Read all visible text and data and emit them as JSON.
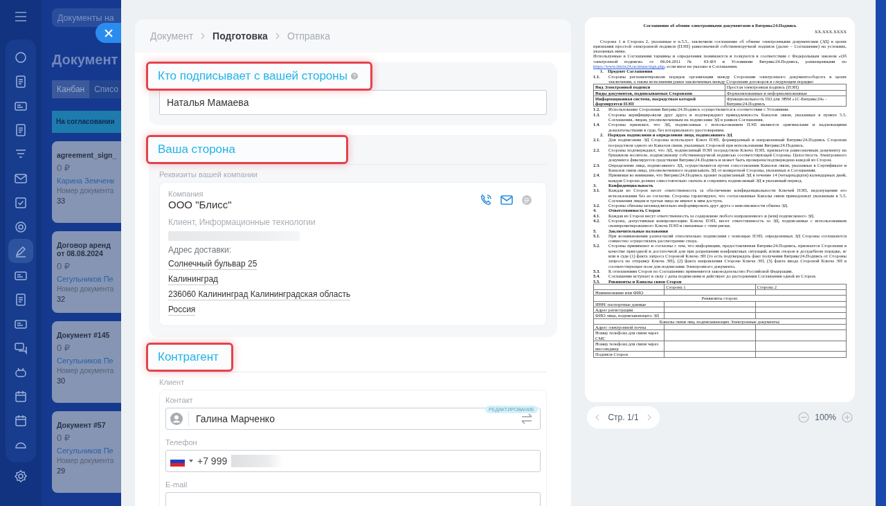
{
  "sidebar": {
    "items": [
      {
        "selected": false
      },
      {
        "selected": false
      },
      {
        "selected": false
      },
      {
        "selected": false
      },
      {
        "selected": false
      },
      {
        "selected": false
      },
      {
        "selected": false
      },
      {
        "selected": false
      },
      {
        "selected": true
      },
      {
        "selected": false
      },
      {
        "selected": false
      },
      {
        "selected": false
      },
      {
        "selected": false
      },
      {
        "selected": false
      },
      {
        "selected": false
      },
      {
        "selected": false
      },
      {
        "selected": false
      }
    ]
  },
  "background": {
    "search": {
      "placeholder": "Документы на"
    },
    "title": "Документ",
    "views": [
      {
        "label": "Канбан",
        "selected": true
      },
      {
        "label": "Списо",
        "selected": false
      }
    ],
    "column": {
      "title": "На согласовании"
    },
    "cards": [
      {
        "title_lines": [
          "agreement_sign_"
        ],
        "amount": "0 ₽",
        "person": "Карина Земченк",
        "number_label": "Номер документа",
        "number": "33"
      },
      {
        "title_lines": [
          "Договор аренд",
          "от 08.08.2024"
        ],
        "amount": "0 ₽",
        "person": "Сегульников Пе",
        "number_label": "Номер документа",
        "number": "32"
      },
      {
        "title_lines": [
          "Документ #145"
        ],
        "amount": "0 ₽",
        "person": "Сегульников Пе",
        "number_label": "Номер документа",
        "number": "30"
      },
      {
        "title_lines": [
          "Документ #57"
        ],
        "amount": "0 ₽",
        "person": "Сегульников Пе",
        "number_label": "Номер документа",
        "number": "29"
      }
    ]
  },
  "steps": [
    {
      "label": "Документ",
      "selected": false
    },
    {
      "label": "Подготовка",
      "selected": true
    },
    {
      "label": "Отправка",
      "selected": false
    }
  ],
  "signer": {
    "title": "Кто подписывает с вашей стороны",
    "highlighted": true,
    "value": "Наталья Мамаева"
  },
  "our_side": {
    "title": "Ваша сторона",
    "highlighted": true,
    "caption": "Реквизиты вашей компании",
    "company_label": "Компания",
    "company": "ООО \"Блисс\"",
    "subtitle": "Клиент, Информационные технологии",
    "address_label": "Адрес доставки:",
    "address_lines": [
      "Солнечный бульвар 25",
      "Калининград",
      "236060 Калининград Калининградская область",
      "Россия"
    ]
  },
  "counterparty": {
    "title": "Контрагент",
    "highlighted": true,
    "caption": "Клиент",
    "contact_label": "Контакт",
    "badge": "РЕДАКТИРОВАНИЕ",
    "contact": "Галина Марченко",
    "phone_label": "Телефон",
    "phone": "+7 999",
    "email_label": "E-mail"
  },
  "document": [
    {
      "kind": "title",
      "text": "Соглашение об обмене электронными документами в Битрикс24.Подпись"
    },
    {
      "kind": "date",
      "text": "XX.XXX.XXXX"
    },
    {
      "kind": "para",
      "text": "Сторона 1 и Сторона 2, указанные в п.5.5., заключили соглашение об обмене электронными документами (ЭД) в целях признания простой электронной подписи (ПЭП) равнозначной собственноручной подписи (далее – Соглашение) на условиях, указанных ниже."
    },
    {
      "kind": "linkpara",
      "text": "Используемые в Соглашении термины и определения понимаются и толкуются в соответствии с Федеральным законом «Об электронной подписи» от 06.04.2011 № 63-ФЗ и Условиями Битрикс24.Подпись, размещенными по",
      "link": "https://www.bitrix24.ru/abuse/sign.php",
      "after": ", если иное не указано в Соглашении."
    },
    {
      "kind": "heading",
      "num": "1.",
      "text": "Предмет Соглашения"
    },
    {
      "kind": "clause",
      "num": "1.1.",
      "text": "Стороны регламентировали порядок организации между Сторонами электронного документооборота в целях заключения, а также исполнения ранее заключенных между Сторонами договоров в следующем порядке:",
      "bold": false
    },
    {
      "kind": "table",
      "rows": [
        [
          "Вид Электронной подписи",
          "Простая электронная подпись (ПЭП)"
        ],
        [
          "Виды документов, подписываемых Сторонами",
          "Формализованные и неформализованные"
        ],
        [
          "Информационная система, посредством которой формируется ПЭП",
          "Функциональность ПО для ЭВМ «1С-Битрикс24» - Битрикс24.Подпись"
        ]
      ]
    },
    {
      "kind": "clause",
      "num": "1.2.",
      "text": "Использование Сторонами Битрикс24.Подпись осуществляется в соответствии с Условиями.",
      "bold": false
    },
    {
      "kind": "clause",
      "num": "1.3.",
      "text": "Стороны верифицировали друг друга и подтверждают принадлежность Каналов связи, указанных в пункте 5.5. Соглашения, лицам, уполномоченным на подписание ЭД в рамках Соглашения.",
      "bold": false
    },
    {
      "kind": "clause",
      "num": "1.4.",
      "text": "Стороны признают, что ЭД, подписанные с использованием ПЭП являются оригиналами и надлежащими доказательствами в суде, без нотариального удостоверения.",
      "bold": false
    },
    {
      "kind": "heading",
      "num": "2.",
      "text": "Порядок подписания и определения лица, подписавшего ЭД"
    },
    {
      "kind": "clause",
      "num": "2.1.",
      "text": "Для подписания ЭД Стороны используют Ключ ПЭП, формируемый и направленный Битрикс24.Подпись Сторонам посредством одного из Каналов связи, указанных Стороной при использовании Битрикс24.Подпись.",
      "bold": false
    },
    {
      "kind": "clause",
      "num": "2.2.",
      "text": "Стороны подтверждают, что ЭД, подписанный ПЭП посредством Ключа ПЭП, признается равнозначным документу на бумажном носителе, подписанному собственноручной подписью соответствующей Стороны. Целостность Электронного документа фиксируется средствами Битрикс24.Подпись и может быть проверена/подтверждена каждой из Сторон.",
      "bold": false
    },
    {
      "kind": "clause",
      "num": "2.3.",
      "text": "Определение лица, подписавшего ЭД, осуществляется путем сопоставления Каналов связи, указанных в Сертификате и Каналов связи лица, уполномоченного подписывать ЭД от конкретной Стороны, указанных в Соглашении.",
      "bold": false
    },
    {
      "kind": "clause",
      "num": "2.4.",
      "text": "Принимая во внимание, что Битрикс24.Подпись хранит подписанный ЭД в течение 14 (четырнадцати) календарных дней, каждая Сторона должна самостоятельно скачать и сохранить подписанный ЭД в указанный период.",
      "bold": false
    },
    {
      "kind": "clause",
      "num": "3.",
      "text": "Конфиденциальность",
      "bold": true
    },
    {
      "kind": "clause",
      "num": "3.1.",
      "text": "Каждая из Сторон несет ответственность за обеспечение конфиденциальности Ключей ПЭП, недопущения его использования без ее согласия. Стороны гарантируют, что согласованные Каналы связи принадлежат указанным в 5.5. Соглашения лицам и третьи лица не имеют к ним доступа.",
      "bold": false
    },
    {
      "kind": "clause",
      "num": "3.2.",
      "text": "Стороны обязаны незамедлительно информировать друг друга о невозможности обмена ЭД.",
      "bold": false
    },
    {
      "kind": "clause",
      "num": "4.",
      "text": "Ответственность Сторон",
      "bold": true
    },
    {
      "kind": "clause",
      "num": "4.1.",
      "text": "Каждая из Сторон несут ответственность за содержание любого направленного и (или) подписанного ЭД.",
      "bold": false
    },
    {
      "kind": "clause",
      "num": "4.2.",
      "text": "Сторона, допустившая компрометацию Ключа ПЭП, несет ответственность за ЭД, подписанные с использованием скомпрометированного Ключа ПЭП и связанные с этим риски.",
      "bold": false
    },
    {
      "kind": "clause",
      "num": "5.",
      "text": "Заключительные положения",
      "bold": true
    },
    {
      "kind": "clause",
      "num": "5.1.",
      "text": "При возникновении разногласий относительно подписания с помощью ПЭП, определенных ЭД Стороны соглашаются совместно осуществлять рассмотрение спора.",
      "bold": false
    },
    {
      "kind": "clause",
      "num": "5.2.",
      "text": "Стороны принимают и согласны с тем, что информация, предоставляемая Битрикс24.Подпись, признается Сторонами в качестве пригодной и достаточной для при разрешении конфликтных ситуаций, и/или споров в досудебном порядке, и/или в суде (1) факта запроса Стороной Ключа ЭП (то есть подтверждать факт получения Битрикс24.Подпись от Стороны запроса на отправку Ключа ЭП), (2) факта направления Стороне Ключа ЭП, (3) факта ввода Стороной Ключа ЭП в соответствующее поле для подписания Электронного документа.",
      "bold": false
    },
    {
      "kind": "clause",
      "num": "5.3.",
      "text": "К отношениям Сторон по Соглашению применяется законодательство Российской Федерации.",
      "bold": false
    },
    {
      "kind": "clause",
      "num": "5.4.",
      "text": "Соглашение вступает в силу с даты подписания и действует до расторжения Соглашения одной из Сторон.",
      "bold": false
    },
    {
      "kind": "clause",
      "num": "5.5.",
      "text": "Реквизиты и Каналы связи Сторон",
      "bold": true
    },
    {
      "kind": "grid",
      "header": [
        "Сторона 1",
        "Сторона 2"
      ],
      "rows": [
        {
          "kind": "row",
          "text": "Наименование или ФИО"
        },
        {
          "kind": "span",
          "text": "Реквизиты сторон:"
        },
        {
          "kind": "row",
          "text": "ИНН/ паспортные данные"
        },
        {
          "kind": "row",
          "text": "Адрес регистрации"
        },
        {
          "kind": "row",
          "text": "ФИО лица, подписывающего ЭД"
        },
        {
          "kind": "span",
          "text": "Каналы связи лиц, подписывающих Электронные документы:"
        },
        {
          "kind": "row",
          "text": "Адрес электронной почты"
        },
        {
          "kind": "row",
          "text": "Номер телефона для связи через СМС"
        },
        {
          "kind": "row",
          "text": "Номер телефона для связи через мессенджер"
        },
        {
          "kind": "row",
          "text": "Подписи Сторон"
        }
      ]
    }
  ],
  "pager": {
    "label": "Стр. 1/1"
  },
  "zoom": {
    "label": "100%"
  }
}
